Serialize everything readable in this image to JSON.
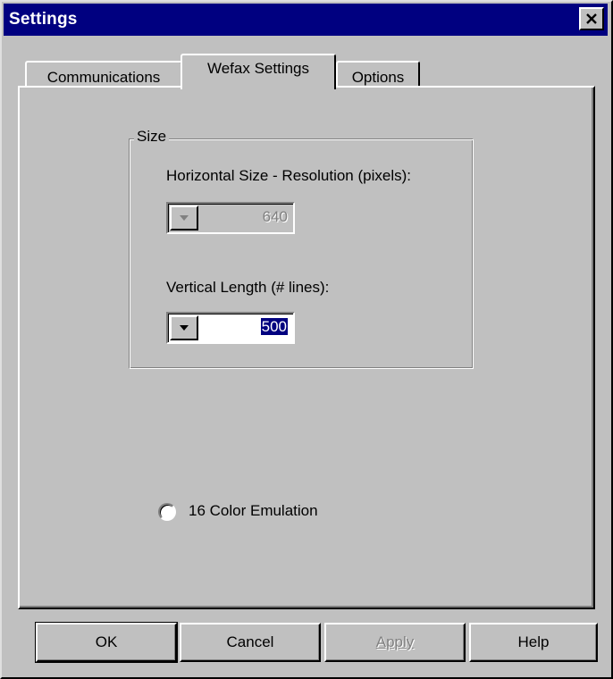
{
  "window": {
    "title": "Settings"
  },
  "tabs": [
    {
      "label": "Communications"
    },
    {
      "label": "Wefax Settings"
    },
    {
      "label": "Options"
    }
  ],
  "size_group": {
    "legend": "Size",
    "horizontal_label": "Horizontal Size - Resolution (pixels):",
    "horizontal_value": "640",
    "vertical_label": "Vertical Length (# lines):",
    "vertical_value": "500"
  },
  "color_emulation": {
    "label": "16 Color Emulation",
    "checked": false
  },
  "buttons": {
    "ok": "OK",
    "cancel": "Cancel",
    "apply": "Apply",
    "help": "Help"
  },
  "icons": {
    "close": "close-icon",
    "dropdown": "chevron-down-icon"
  },
  "colors": {
    "titlebar": "#000080",
    "face": "#c0c0c0",
    "selection": "#000080"
  }
}
